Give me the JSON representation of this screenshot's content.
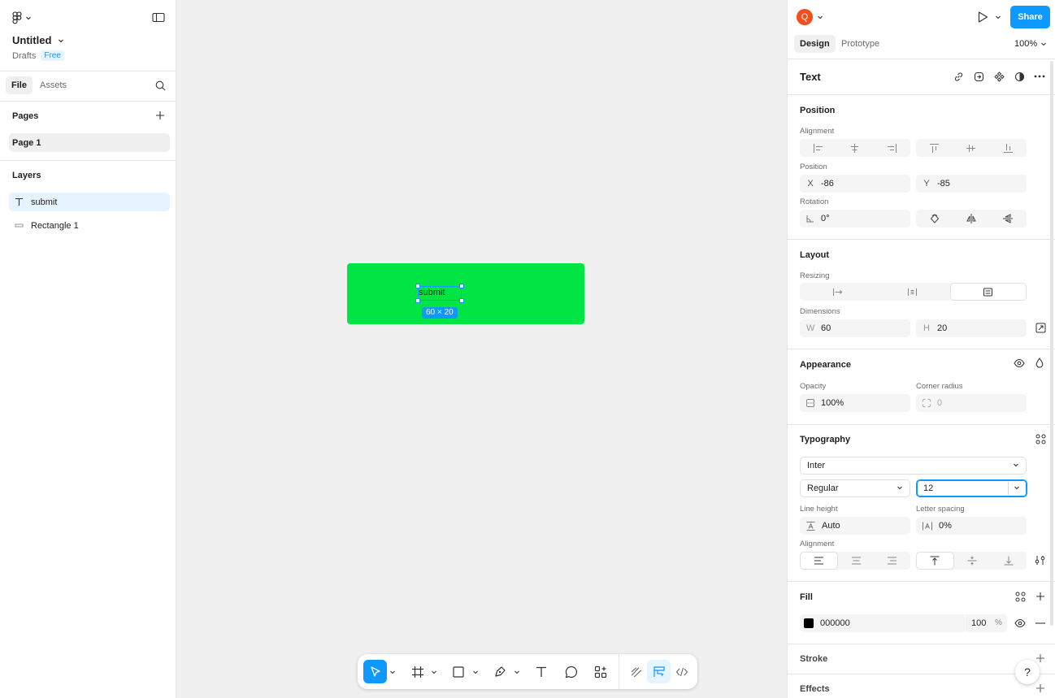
{
  "file": {
    "title": "Untitled",
    "location": "Drafts",
    "plan": "Free"
  },
  "left_tabs": {
    "file": "File",
    "assets": "Assets"
  },
  "pages": {
    "heading": "Pages",
    "items": [
      "Page 1"
    ]
  },
  "layers": {
    "heading": "Layers",
    "items": [
      {
        "name": "submit",
        "type": "text",
        "selected": true
      },
      {
        "name": "Rectangle 1",
        "type": "rectangle",
        "selected": false
      }
    ]
  },
  "canvas": {
    "button_label": "submit",
    "size_badge": "60 × 20",
    "rect_color": "#00e544"
  },
  "header": {
    "avatar_initial": "Q",
    "share_label": "Share",
    "design_tab": "Design",
    "prototype_tab": "Prototype",
    "zoom": "100%"
  },
  "panel": {
    "title": "Text",
    "position": {
      "heading": "Position",
      "alignment_label": "Alignment",
      "position_label": "Position",
      "x_prefix": "X",
      "x": "-86",
      "y_prefix": "Y",
      "y": "-85",
      "rotation_label": "Rotation",
      "rotation": "0°"
    },
    "layout": {
      "heading": "Layout",
      "resizing_label": "Resizing",
      "dimensions_label": "Dimensions",
      "w_prefix": "W",
      "w": "60",
      "h_prefix": "H",
      "h": "20"
    },
    "appearance": {
      "heading": "Appearance",
      "opacity_label": "Opacity",
      "opacity": "100%",
      "radius_label": "Corner radius",
      "radius": "0"
    },
    "typography": {
      "heading": "Typography",
      "font": "Inter",
      "weight": "Regular",
      "size": "12",
      "line_height_label": "Line height",
      "line_height": "Auto",
      "letter_spacing_label": "Letter spacing",
      "letter_spacing": "0%",
      "alignment_label": "Alignment"
    },
    "fill": {
      "heading": "Fill",
      "hex": "000000",
      "opacity": "100",
      "percent": "%",
      "swatch_color": "#000000"
    },
    "stroke": {
      "heading": "Stroke"
    },
    "effects": {
      "heading": "Effects"
    }
  },
  "help_label": "?",
  "colors": {
    "accent": "#0d99ff",
    "avatar": "#f24e1e",
    "selection_bg": "#e5f4ff"
  }
}
